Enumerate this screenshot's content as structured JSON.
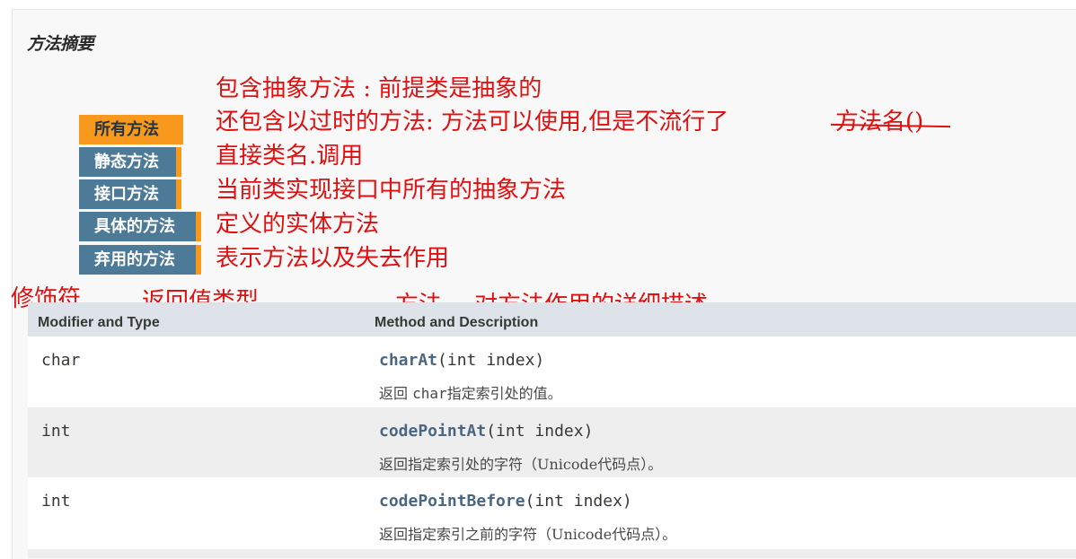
{
  "section": {
    "title": "方法摘要"
  },
  "tabs": [
    {
      "label": "所有方法",
      "active": true
    },
    {
      "label": "静态方法",
      "active": false
    },
    {
      "label": "接口方法",
      "active": false
    },
    {
      "label": "具体的方法",
      "active": false
    },
    {
      "label": "弃用的方法",
      "active": false
    }
  ],
  "annotations": {
    "abstract": "包含抽象方法 : 前提类是抽象的",
    "deprecated": "还包含以过时的方法: 方法可以使用,但是不流行了",
    "deprecated_strike": "方法名()",
    "static": "直接类名.调用",
    "interface": "当前类实现接口中所有的抽象方法",
    "concrete": "定义的实体方法",
    "all": "表示方法以及失去作用",
    "modifier": "修饰符",
    "return_type": "返回值类型",
    "method": "方法",
    "method_desc": "对方法作用的详细描述"
  },
  "table": {
    "headers": [
      "Modifier and Type",
      "Method and Description"
    ],
    "rows": [
      {
        "type": "char",
        "method": "charAt",
        "params": "(int index)",
        "desc_prefix": "返回 ",
        "desc_code": "char",
        "desc_suffix": "指定索引处的值。"
      },
      {
        "type": "int",
        "method": "codePointAt",
        "params": "(int index)",
        "desc_prefix": "返回指定索引处的字符（Unicode代码点）。",
        "desc_code": "",
        "desc_suffix": ""
      },
      {
        "type": "int",
        "method": "codePointBefore",
        "params": "(int index)",
        "desc_prefix": "返回指定索引之前的字符（Unicode代码点）。",
        "desc_code": "",
        "desc_suffix": ""
      }
    ]
  },
  "colors": {
    "tab_active": "#f8981d",
    "tab_inactive": "#4d7a97",
    "annotation": "#e01010",
    "header_bg": "#dee3e9",
    "method_link": "#4a6782"
  }
}
